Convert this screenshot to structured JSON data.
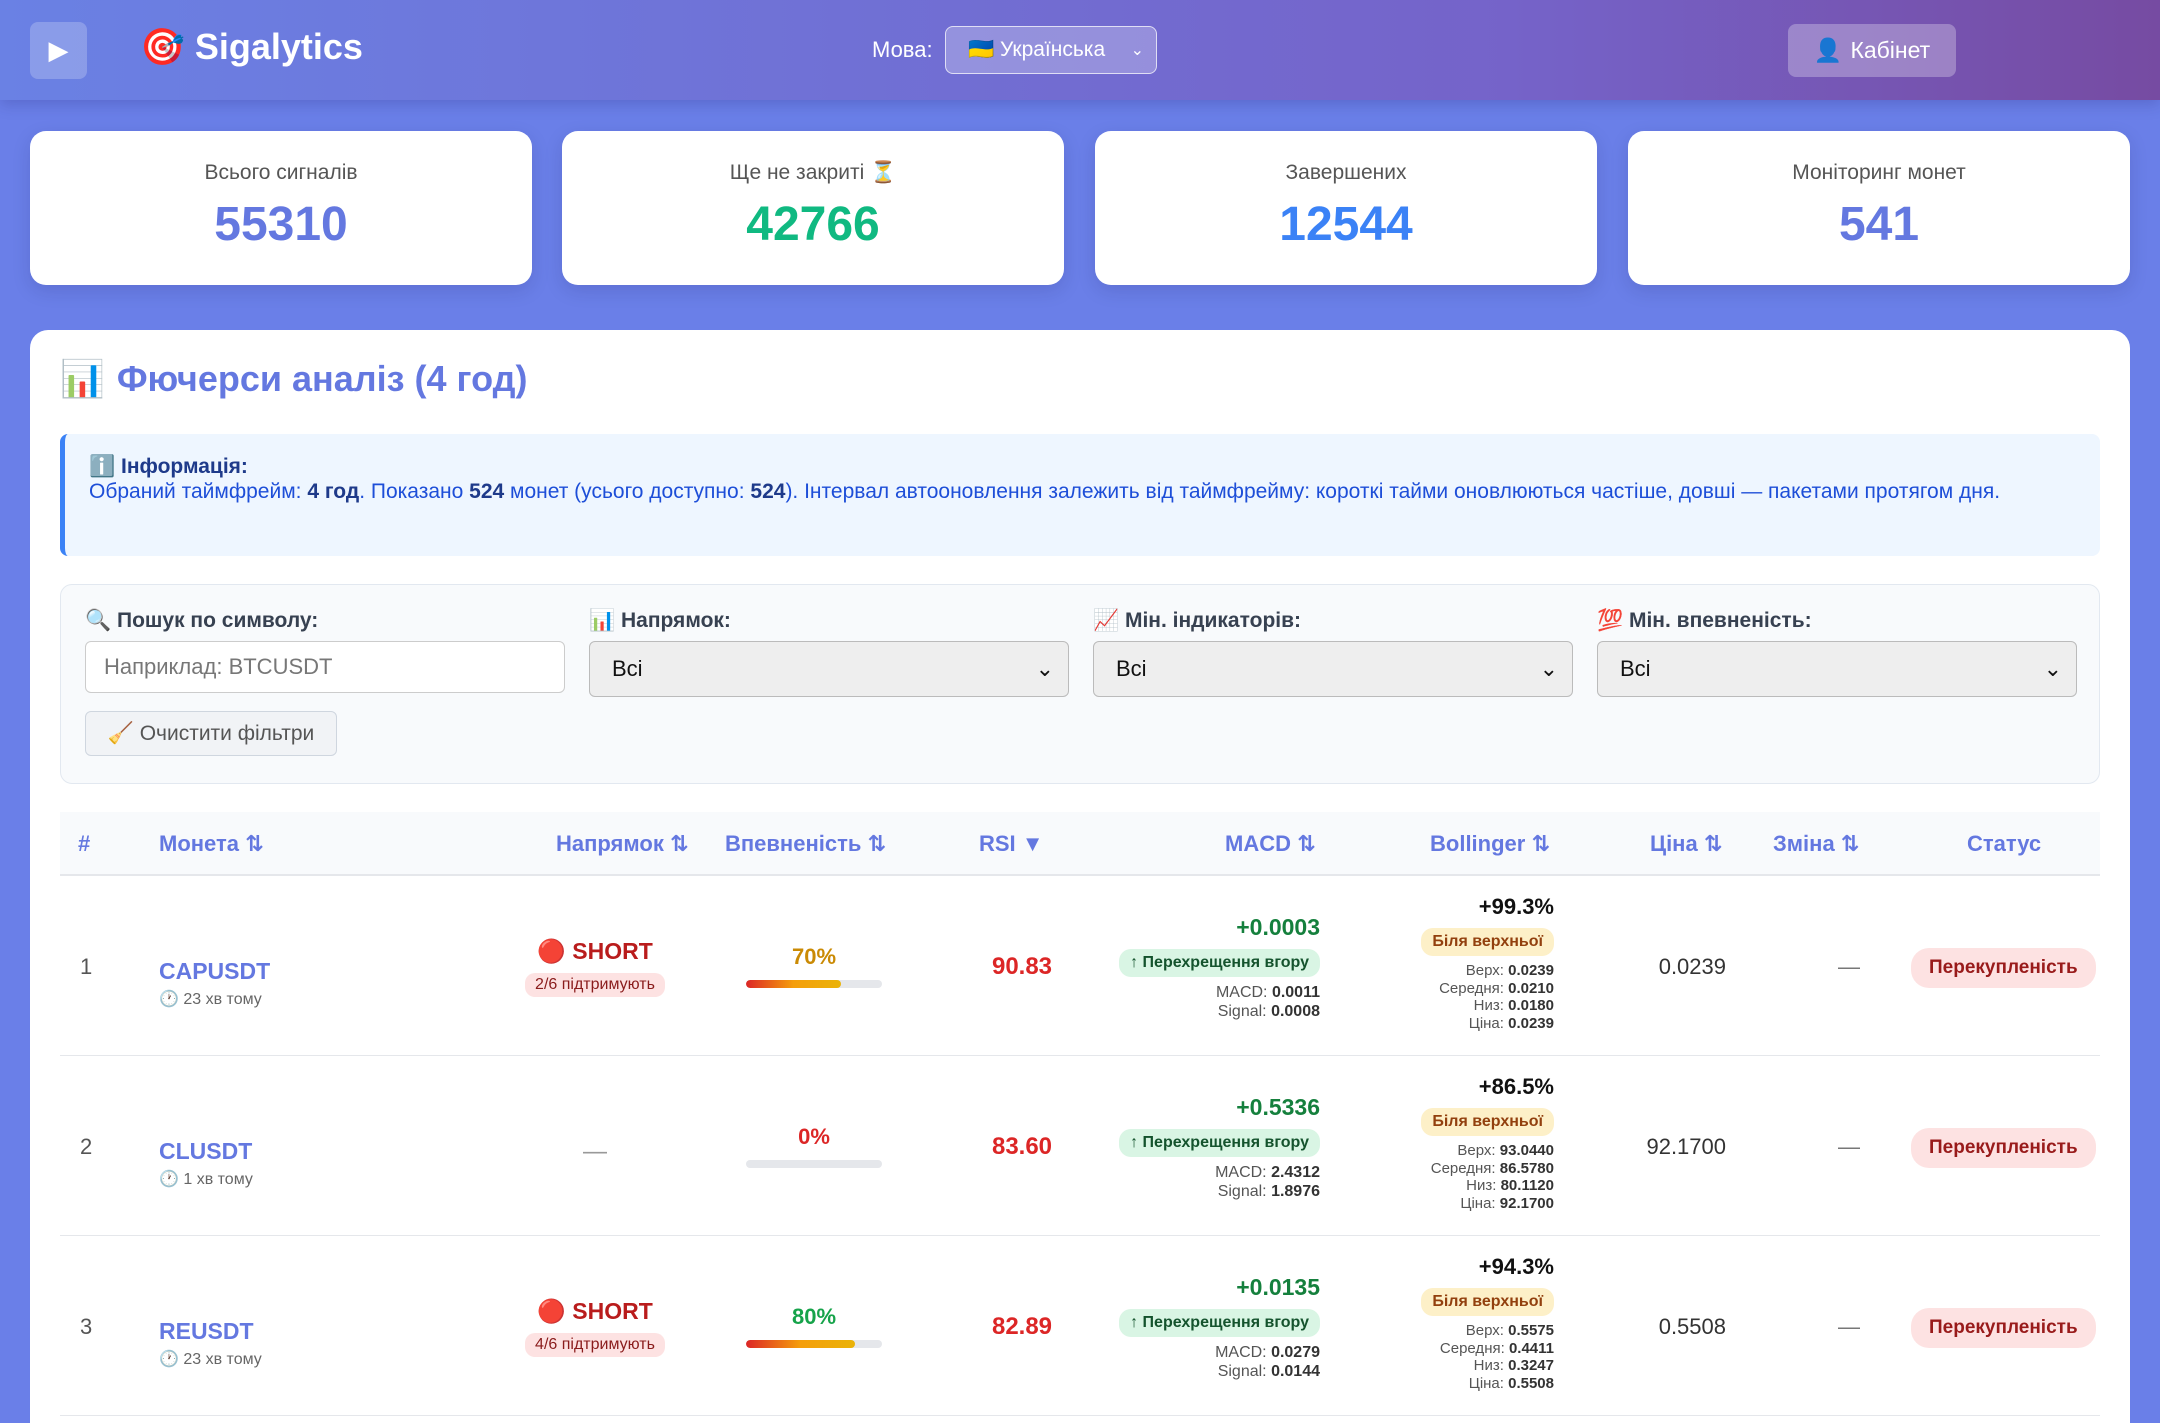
{
  "header": {
    "menu_icon": "play-icon",
    "brand_emoji": "🎯",
    "brand": "Sigalytics",
    "lang_label": "Мова:",
    "lang_value": "🇺🇦 Українська",
    "cabinet_emoji": "👤",
    "cabinet_label": "Кабінет"
  },
  "stats": [
    {
      "label": "Всього сигналів",
      "value": "55310",
      "color": "#6478e0"
    },
    {
      "label": "Ще не закриті ⏳",
      "value": "42766",
      "color": "#10b981"
    },
    {
      "label": "Завершених",
      "value": "12544",
      "color": "#3b82f6"
    },
    {
      "label": "Моніторинг монет",
      "value": "541",
      "color": "#6478e0"
    }
  ],
  "panel": {
    "title_emoji": "📊",
    "title": "Фючерси аналіз (4 год)"
  },
  "info": {
    "heading": "ℹ️ Інформація:",
    "t1": "Обраний таймфрейм: ",
    "timeframe": "4 год",
    "t2": ". Показано ",
    "shown": "524",
    "t3": " монет (усього доступно: ",
    "total": "524",
    "t4": "). Інтервал автооновлення залежить від таймфрейму: короткі тайми оновлюються частіше, довші — пакетами протягом дня."
  },
  "filters": {
    "search_label": "🔍 Пошук по символу:",
    "search_placeholder": "Наприклад: BTCUSDT",
    "direction_label": "📊 Напрямок:",
    "direction_value": "Всі",
    "indicators_label": "📈 Мін. індикаторів:",
    "indicators_value": "Всі",
    "confidence_label": "💯 Мін. впевненість:",
    "confidence_value": "Всі",
    "clear_label": "🧹 Очистити фільтри"
  },
  "table": {
    "headers": {
      "idx": "#",
      "coin": "Монета ⇅",
      "direction": "Напрямок ⇅",
      "confidence": "Впевненість ⇅",
      "rsi": "RSI ▼",
      "macd": "MACD ⇅",
      "bollinger": "Bollinger ⇅",
      "price": "Ціна ⇅",
      "change": "Зміна ⇅",
      "status": "Статус"
    },
    "rows": [
      {
        "idx": "1",
        "symbol": "CAPUSDT",
        "ago": "🕐 23 хв тому",
        "direction": "🔴 SHORT",
        "support": "2/6 підтримують",
        "confidence": "70%",
        "confidence_value": 70,
        "confidence_color": "#ca8a04",
        "rsi": "90.83",
        "macd_delta": "+0.0003",
        "macd_cross": "↑ Перехрещення вгору",
        "macd": "0.0011",
        "signal": "0.0008",
        "boll_pct": "+99.3%",
        "boll_badge": "Біля верхньої",
        "upper": "0.0239",
        "middle": "0.0210",
        "lower": "0.0180",
        "boll_price": "0.0239",
        "price": "0.0239",
        "change": "—",
        "status": "Перекупленість"
      },
      {
        "idx": "2",
        "symbol": "CLUSDT",
        "ago": "🕐 1 хв тому",
        "direction": "",
        "support": "",
        "direction_dash": "—",
        "confidence": "0%",
        "confidence_value": 0,
        "confidence_color": "#dc2626",
        "rsi": "83.60",
        "macd_delta": "+0.5336",
        "macd_cross": "↑ Перехрещення вгору",
        "macd": "2.4312",
        "signal": "1.8976",
        "boll_pct": "+86.5%",
        "boll_badge": "Біля верхньої",
        "upper": "93.0440",
        "middle": "86.5780",
        "lower": "80.1120",
        "boll_price": "92.1700",
        "price": "92.1700",
        "change": "—",
        "status": "Перекупленість"
      },
      {
        "idx": "3",
        "symbol": "REUSDT",
        "ago": "🕐 23 хв тому",
        "direction": "🔴 SHORT",
        "support": "4/6 підтримують",
        "confidence": "80%",
        "confidence_value": 80,
        "confidence_color": "#16a34a",
        "rsi": "82.89",
        "macd_delta": "+0.0135",
        "macd_cross": "↑ Перехрещення вгору",
        "macd": "0.0279",
        "signal": "0.0144",
        "boll_pct": "+94.3%",
        "boll_badge": "Біля верхньої",
        "upper": "0.5575",
        "middle": "0.4411",
        "lower": "0.3247",
        "boll_price": "0.5508",
        "price": "0.5508",
        "change": "—",
        "status": "Перекупленість"
      }
    ],
    "labels": {
      "macd": "MACD: ",
      "signal": "Signal: ",
      "upper": "Верх: ",
      "middle": "Середня: ",
      "lower": "Низ: ",
      "price": "Ціна: "
    }
  }
}
